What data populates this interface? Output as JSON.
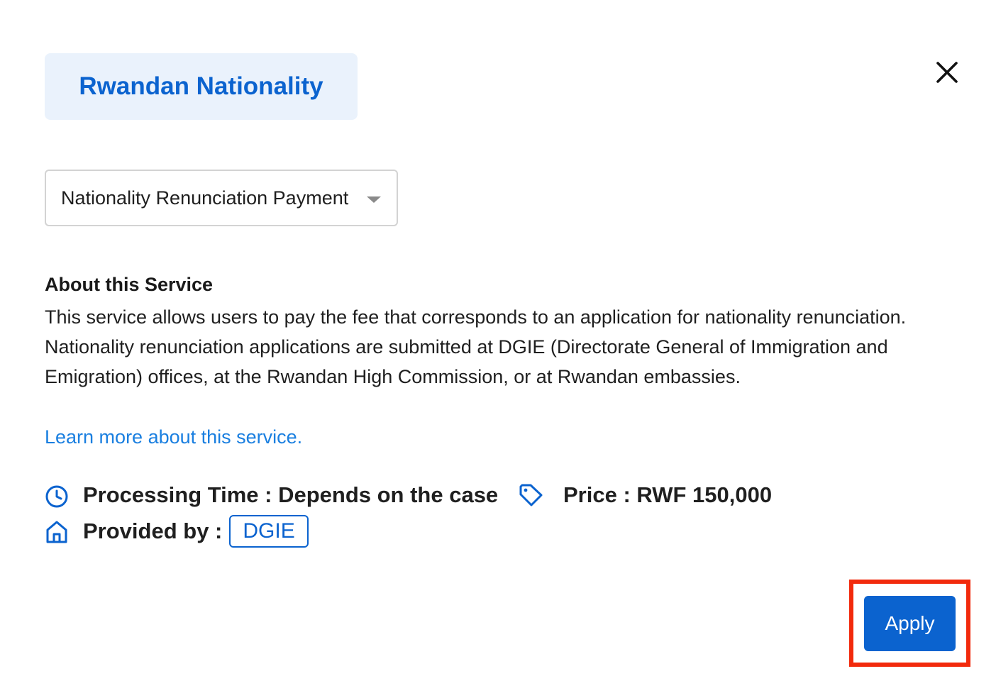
{
  "category": {
    "title": "Rwandan Nationality"
  },
  "close": {
    "icon": "close-icon"
  },
  "service_select": {
    "selected": "Nationality Renunciation Payment"
  },
  "about": {
    "heading": "About this Service",
    "body": "This service allows users to pay the fee that corresponds to an application for nationality renunciation. Nationality renunciation applications are submitted at DGIE (Directorate General of Immigration and Emigration) offices, at the Rwandan High Commission, or at Rwandan embassies."
  },
  "learn_more": {
    "label": "Learn more about this service."
  },
  "meta": {
    "processing_time": "Processing Time : Depends on the case",
    "price": "Price : RWF 150,000",
    "provided_by_label": "Provided by :",
    "provider": "DGIE",
    "icons": [
      "clock-icon",
      "tag-icon",
      "building-icon"
    ]
  },
  "actions": {
    "apply_label": "Apply"
  },
  "colors": {
    "accent": "#0b63cf",
    "link": "#1a7fe0",
    "chip_bg": "#eaf2fc",
    "highlight": "#f22a0c"
  }
}
